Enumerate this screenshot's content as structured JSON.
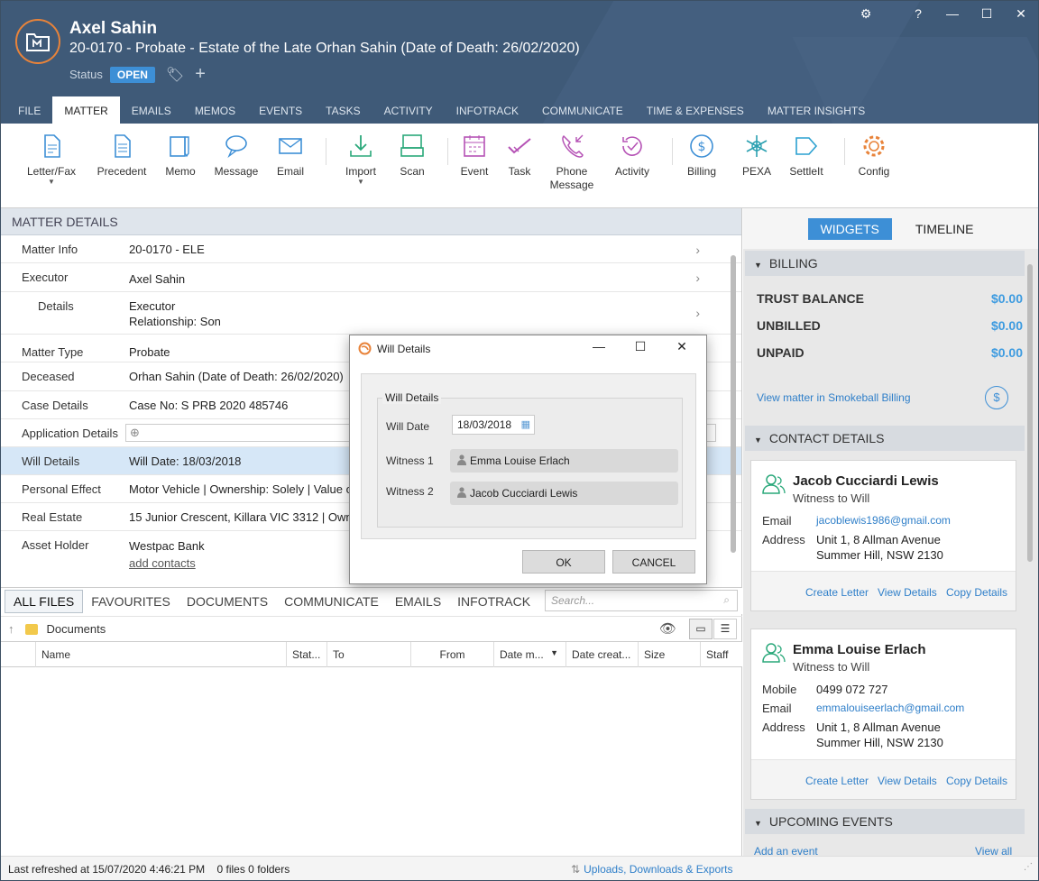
{
  "header": {
    "client_name": "Axel Sahin",
    "matter_title": "20-0170 - Probate - Estate of the Late Orhan Sahin (Date of Death: 26/02/2020)",
    "status_label": "Status",
    "status_value": "OPEN",
    "window_buttons": [
      "⚙",
      "?",
      "—",
      "☐",
      "✕"
    ]
  },
  "tabs": [
    "FILE",
    "MATTER",
    "EMAILS",
    "MEMOS",
    "EVENTS",
    "TASKS",
    "ACTIVITY",
    "INFOTRACK",
    "COMMUNICATE",
    "TIME & EXPENSES",
    "MATTER INSIGHTS"
  ],
  "ribbon": [
    {
      "label": "Letter/Fax",
      "icon": "letter-icon"
    },
    {
      "label": "Precedent",
      "icon": "precedent-icon"
    },
    {
      "label": "Memo",
      "icon": "memo-icon"
    },
    {
      "label": "Message",
      "icon": "message-icon"
    },
    {
      "label": "Email",
      "icon": "email-icon"
    },
    {
      "label": "Import",
      "icon": "import-icon"
    },
    {
      "label": "Scan",
      "icon": "scan-icon"
    },
    {
      "label": "Event",
      "icon": "event-icon"
    },
    {
      "label": "Task",
      "icon": "task-icon"
    },
    {
      "label": "Phone\nMessage",
      "icon": "phone-icon"
    },
    {
      "label": "Activity",
      "icon": "activity-icon"
    },
    {
      "label": "Billing",
      "icon": "billing-icon"
    },
    {
      "label": "PEXA",
      "icon": "pexa-icon"
    },
    {
      "label": "SettleIt",
      "icon": "settleit-icon"
    },
    {
      "label": "Config",
      "icon": "config-icon"
    }
  ],
  "matter_details": {
    "title": "MATTER DETAILS",
    "rows": [
      {
        "label": "Matter Info",
        "value": "20-0170 - ELE"
      },
      {
        "label": "Executor",
        "value": "Axel Sahin"
      },
      {
        "label": "Details",
        "value": "Executor",
        "value2": "Relationship: Son"
      },
      {
        "label": "Matter Type",
        "value": "Probate"
      },
      {
        "label": "Deceased",
        "value": "Orhan Sahin (Date of Death: 26/02/2020)"
      },
      {
        "label": "Case Details",
        "value": "Case No: S PRB 2020 485746"
      },
      {
        "label": "Application Details",
        "value": ""
      },
      {
        "label": "Will Details",
        "value": "Will Date: 18/03/2018"
      },
      {
        "label": "Personal Effect",
        "value": "Motor Vehicle | Ownership: Solely | Value o"
      },
      {
        "label": "Real Estate",
        "value": "15 Junior Crescent, Killara VIC 3312 | Owne"
      },
      {
        "label": "Asset Holder",
        "value": "Westpac Bank",
        "value2": "add contacts"
      }
    ]
  },
  "documents": {
    "tabs": [
      "ALL FILES",
      "FAVOURITES",
      "DOCUMENTS",
      "COMMUNICATE",
      "EMAILS",
      "INFOTRACK"
    ],
    "search_placeholder": "Search...",
    "path": "Documents",
    "columns": [
      "Name",
      "Stat...",
      "To",
      "From",
      "Date m...",
      "Date creat...",
      "Size",
      "Staff"
    ]
  },
  "status_bar": {
    "refreshed": "Last refreshed at 15/07/2020 4:46:21 PM",
    "counts": "0 files  0 folders",
    "uploads": "Uploads, Downloads & Exports"
  },
  "right": {
    "tabs": [
      "WIDGETS",
      "TIMELINE"
    ],
    "billing": {
      "title": "BILLING",
      "rows": [
        {
          "label": "TRUST BALANCE",
          "value": "$0.00"
        },
        {
          "label": "UNBILLED",
          "value": "$0.00"
        },
        {
          "label": "UNPAID",
          "value": "$0.00"
        }
      ],
      "link": "View matter in Smokeball Billing"
    },
    "contacts_title": "CONTACT DETAILS",
    "contacts": [
      {
        "name": "Jacob Cucciardi Lewis",
        "role": "Witness to Will",
        "email_label": "Email",
        "email": "jacoblewis1986@gmail.com",
        "address_label": "Address",
        "address1": "Unit 1, 8 Allman Avenue",
        "address2": "Summer Hill, NSW 2130"
      },
      {
        "name": "Emma Louise Erlach",
        "role": "Witness to Will",
        "mobile_label": "Mobile",
        "mobile": "0499 072 727",
        "email_label": "Email",
        "email": "emmalouiseerlach@gmail.com",
        "address_label": "Address",
        "address1": "Unit 1, 8 Allman Avenue",
        "address2": "Summer Hill, NSW 2130"
      }
    ],
    "card_actions": [
      "Create Letter",
      "View Details",
      "Copy Details"
    ],
    "events": {
      "title": "UPCOMING EVENTS",
      "add": "Add an event",
      "all": "View all"
    }
  },
  "dialog": {
    "title": "Will Details",
    "legend": "Will Details",
    "will_date_label": "Will Date",
    "will_date": "18/03/2018",
    "witness1_label": "Witness 1",
    "witness1": "Emma Louise Erlach",
    "witness2_label": "Witness 2",
    "witness2": "Jacob Cucciardi Lewis",
    "ok": "OK",
    "cancel": "CANCEL"
  },
  "colors": {
    "header": "#3f5a78",
    "accent": "#3d8fd6",
    "money": "#3d9be0",
    "link": "#2f7fc9",
    "orange": "#e8833a"
  }
}
